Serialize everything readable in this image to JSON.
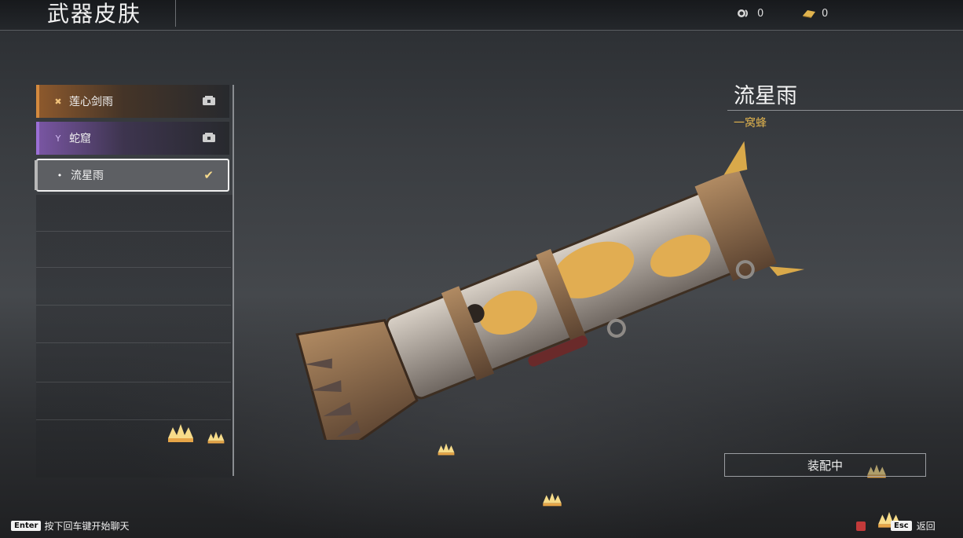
{
  "header": {
    "title": "武器皮肤",
    "currencies": [
      {
        "icon": "coin-icon",
        "value": "0"
      },
      {
        "icon": "gold-ingot-icon",
        "value": "0"
      }
    ]
  },
  "skins": [
    {
      "name": "莲心剑雨",
      "rarity": "orange",
      "state": "locked"
    },
    {
      "name": "蛇窟",
      "rarity": "purple",
      "state": "locked"
    },
    {
      "name": "流星雨",
      "rarity": "white",
      "state": "equipped"
    }
  ],
  "detail": {
    "title": "流星雨",
    "subtitle": "一窝蜂",
    "equip_label": "装配中"
  },
  "footer": {
    "enter_key": "Enter",
    "enter_hint": "按下回车键开始聊天",
    "esc_key": "Esc",
    "esc_hint": "返回"
  },
  "colors": {
    "accent_gold": "#e0b34e",
    "orange": "#d48a3e",
    "purple": "#9b6fd6"
  }
}
